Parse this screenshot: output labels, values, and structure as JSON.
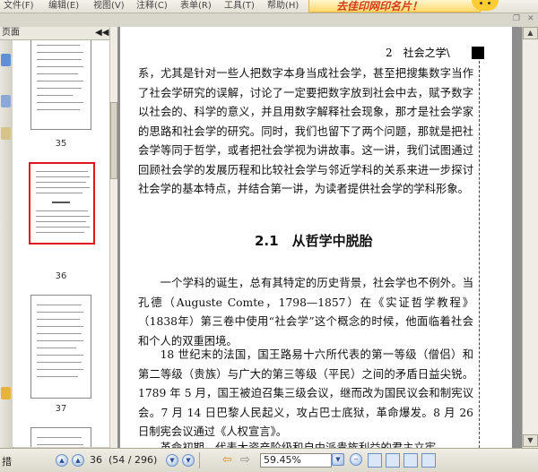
{
  "menubar": {
    "items": [
      "文件(F)",
      "编辑(E)",
      "视图(V)",
      "注释(C)",
      "表单(R)",
      "工具(T)",
      "帮助(H)"
    ],
    "ad_text": "去佳印网印名片！"
  },
  "thumbnails": {
    "panel_title": "页面",
    "collapse_icon": "chevron-left-double",
    "pages": [
      {
        "number": "35",
        "selected": false
      },
      {
        "number": "36",
        "selected": true
      },
      {
        "number": "37",
        "selected": false
      }
    ]
  },
  "document": {
    "running_head": "2　社会之学\\",
    "paragraphs": [
      "系，尤其是针对一些人把数字本身当成社会学，甚至把搜集数字当作了社会学研究的误解，讨论了一定要把数字放到社会中去，赋予数字以社会的、科学的意义，并且用数字解释社会现象，那才是社会学家的思路和社会学的研究。同时，我们也留下了两个问题，那就是把社会学等同于哲学，或者把社会学视为讲故事。这一讲，我们试图通过回顾社会学的发展历程和比较社会学与邻近学科的关系来进一步探讨社会学的基本特点，并结合第一讲，为读者提供社会学的学科形象。"
    ],
    "section_heading": "2.1　从哲学中脱胎",
    "section_paragraphs": [
      "一个学科的诞生，总有其特定的历史背景，社会学也不例外。当孔德（Auguste Comte，1798—1857）在《实证哲学教程》（1838年）第三卷中使用“社会学”这个概念的时候，他面临着社会和个人的双重困境。",
      "18 世纪末的法国，国王路易十六所代表的第一等级（僧侣）和第二等级（贵族）与广大的第三等级（平民）之间的矛盾日益尖锐。1789 年 5 月，国王被迫召集三级会议，继而改为国民议会和制宪议会。7 月 14 日巴黎人民起义，攻占巴士底狱，革命爆发。8 月 26 日制宪会议通过《人权宣言》。",
      "革命初期，代表大资产阶级和自由派贵族利益的君主立宪"
    ]
  },
  "statusbar": {
    "left_text": "措",
    "page_number": "36",
    "page_info": "(54 / 296)",
    "zoom": "59.45%"
  }
}
